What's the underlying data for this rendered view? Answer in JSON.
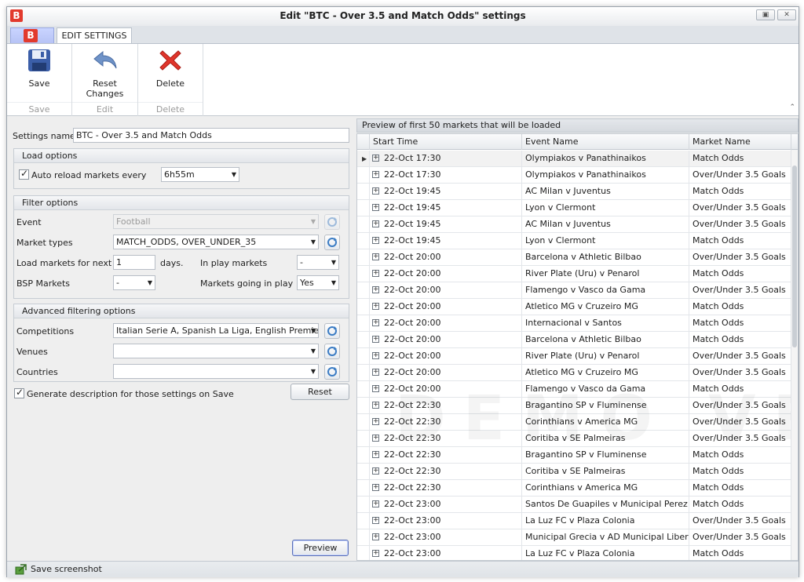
{
  "window": {
    "title": "Edit \"BTC - Over 3.5 and Match Odds\" settings",
    "app_logo": "B",
    "buttons": [
      "restore-icon",
      "close-icon"
    ]
  },
  "ribbon": {
    "tab": "EDIT SETTINGS",
    "groups": [
      {
        "button": "Save",
        "caption": "Save",
        "icon": "floppy-disk-icon"
      },
      {
        "button_line1": "Reset",
        "button_line2": "Changes",
        "caption": "Edit",
        "icon": "undo-arrow-icon"
      },
      {
        "button": "Delete",
        "caption": "Delete",
        "icon": "red-x-icon"
      }
    ]
  },
  "settings": {
    "name_label": "Settings name",
    "name_value": "BTC - Over 3.5 and Match Odds"
  },
  "load_options": {
    "header": "Load options",
    "auto_reload_label": "Auto reload markets every",
    "auto_reload_checked": true,
    "interval": "6h55m"
  },
  "filter_options": {
    "header": "Filter options",
    "event_label": "Event",
    "event_value": "Football",
    "market_types_label": "Market types",
    "market_types_value": "MATCH_ODDS, OVER_UNDER_35",
    "load_next_label": "Load markets for next",
    "load_next_value": "1",
    "days_label": "days.",
    "in_play_label": "In play markets",
    "in_play_value": "-",
    "bsp_label": "BSP Markets",
    "bsp_value": "-",
    "going_in_play_label": "Markets going in play",
    "going_in_play_value": "Yes"
  },
  "advanced": {
    "header": "Advanced filtering options",
    "competitions_label": "Competitions",
    "competitions_value": "Italian Serie A, Spanish La Liga, English Premier ...",
    "venues_label": "Venues",
    "venues_value": "",
    "countries_label": "Countries",
    "countries_value": ""
  },
  "generate_description": {
    "label": "Generate description for those settings on Save",
    "checked": true
  },
  "buttons": {
    "reset": "Reset",
    "preview": "Preview"
  },
  "preview": {
    "header": "Preview of first 50 markets that will be loaded",
    "columns": [
      "Start Time",
      "Event Name",
      "Market Name"
    ],
    "rows": [
      [
        "22-Oct 17:30",
        "Olympiakos v Panathinaikos",
        "Match Odds"
      ],
      [
        "22-Oct 17:30",
        "Olympiakos v Panathinaikos",
        "Over/Under 3.5 Goals"
      ],
      [
        "22-Oct 19:45",
        "AC Milan v Juventus",
        "Match Odds"
      ],
      [
        "22-Oct 19:45",
        "Lyon v Clermont",
        "Over/Under 3.5 Goals"
      ],
      [
        "22-Oct 19:45",
        "AC Milan v Juventus",
        "Over/Under 3.5 Goals"
      ],
      [
        "22-Oct 19:45",
        "Lyon v Clermont",
        "Match Odds"
      ],
      [
        "22-Oct 20:00",
        "Barcelona v Athletic Bilbao",
        "Over/Under 3.5 Goals"
      ],
      [
        "22-Oct 20:00",
        "River Plate (Uru) v Penarol",
        "Match Odds"
      ],
      [
        "22-Oct 20:00",
        "Flamengo v Vasco da Gama",
        "Over/Under 3.5 Goals"
      ],
      [
        "22-Oct 20:00",
        "Atletico MG v Cruzeiro MG",
        "Match Odds"
      ],
      [
        "22-Oct 20:00",
        "Internacional v Santos",
        "Match Odds"
      ],
      [
        "22-Oct 20:00",
        "Barcelona v Athletic Bilbao",
        "Match Odds"
      ],
      [
        "22-Oct 20:00",
        "River Plate (Uru) v Penarol",
        "Over/Under 3.5 Goals"
      ],
      [
        "22-Oct 20:00",
        "Atletico MG v Cruzeiro MG",
        "Over/Under 3.5 Goals"
      ],
      [
        "22-Oct 20:00",
        "Flamengo v Vasco da Gama",
        "Match Odds"
      ],
      [
        "22-Oct 22:30",
        "Bragantino SP v Fluminense",
        "Over/Under 3.5 Goals"
      ],
      [
        "22-Oct 22:30",
        "Corinthians v America MG",
        "Over/Under 3.5 Goals"
      ],
      [
        "22-Oct 22:30",
        "Coritiba v SE Palmeiras",
        "Over/Under 3.5 Goals"
      ],
      [
        "22-Oct 22:30",
        "Bragantino SP v Fluminense",
        "Match Odds"
      ],
      [
        "22-Oct 22:30",
        "Coritiba v SE Palmeiras",
        "Match Odds"
      ],
      [
        "22-Oct 22:30",
        "Corinthians v America MG",
        "Match Odds"
      ],
      [
        "22-Oct 23:00",
        "Santos De Guapiles v Municipal Perez Zel...",
        "Match Odds"
      ],
      [
        "22-Oct 23:00",
        "La Luz FC v Plaza Colonia",
        "Over/Under 3.5 Goals"
      ],
      [
        "22-Oct 23:00",
        "Municipal Grecia v AD Municipal Liberia",
        "Over/Under 3.5 Goals"
      ],
      [
        "22-Oct 23:00",
        "La Luz FC v Plaza Colonia",
        "Match Odds"
      ]
    ]
  },
  "watermark": "DEMO VERSION",
  "status": {
    "text": "Save screenshot",
    "icon": "screenshot-icon"
  },
  "colors": {
    "accent": "#e23a2d",
    "ribbon_tab": "#b7c3f5"
  }
}
